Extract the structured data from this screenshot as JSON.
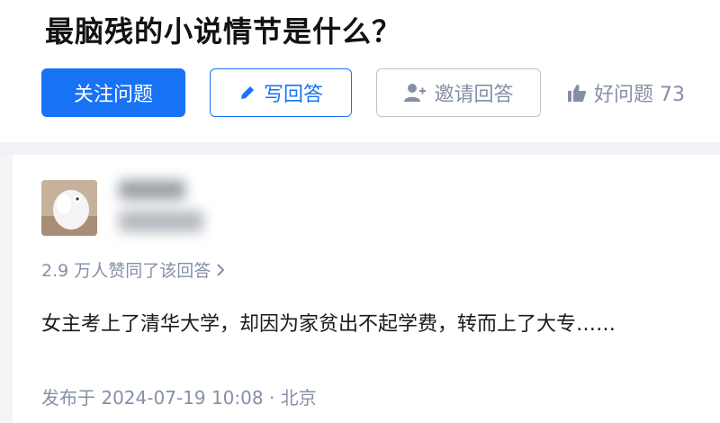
{
  "question": {
    "title": "最脑残的小说情节是什么？",
    "follow_label": "关注问题",
    "write_label": "写回答",
    "invite_label": "邀请回答",
    "good_question_label": "好问题 73"
  },
  "answer": {
    "author_name": "",
    "votes_text": "2.9 万人赞同了该回答",
    "content": "女主考上了清华大学，却因为家贫出不起学费，转而上了大专……",
    "meta": "发布于 2024-07-19 10:08 · 北京"
  },
  "colors": {
    "primary": "#1772f6",
    "muted": "#8590a6",
    "divider": "#f0f2f5"
  },
  "icons": {
    "write": "pencil-icon",
    "invite": "add-user-icon",
    "good_question": "thumbs-up-icon",
    "votes_more": "chevron-right-icon"
  }
}
